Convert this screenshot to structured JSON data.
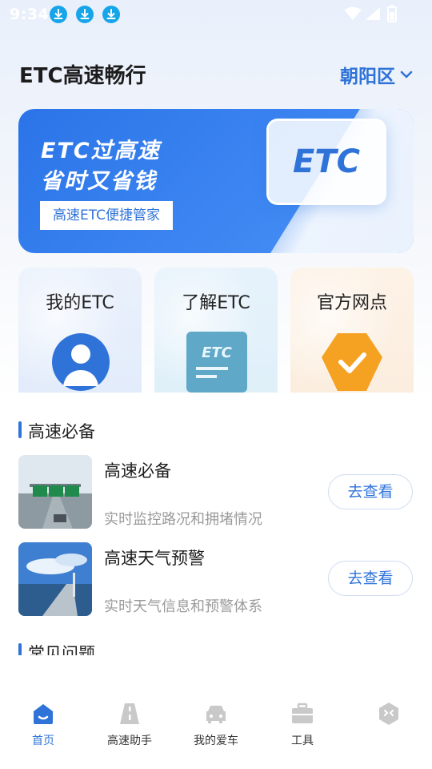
{
  "status_bar": {
    "time": "9:34"
  },
  "header": {
    "title": "ETC高速畅行",
    "region": "朝阳区"
  },
  "banner": {
    "headline_1": "ETC过高速",
    "headline_2": "省时又省钱",
    "subtitle": "高速ETC便捷管家",
    "card_text": "ETC"
  },
  "quick_cards": [
    {
      "label": "我的ETC",
      "icon": "user-icon"
    },
    {
      "label": "了解ETC",
      "icon": "etc-card-icon"
    },
    {
      "label": "官方网点",
      "icon": "check-badge-icon"
    }
  ],
  "section_essentials": {
    "title": "高速必备",
    "items": [
      {
        "title": "高速必备",
        "desc": "实时监控路况和拥堵情况",
        "button": "去查看"
      },
      {
        "title": "高速天气预警",
        "desc": "实时天气信息和预警体系",
        "button": "去查看"
      }
    ]
  },
  "section_faq": {
    "title": "常见问题"
  },
  "tabbar": {
    "tabs": [
      {
        "label": "首页",
        "icon": "home-icon"
      },
      {
        "label": "高速助手",
        "icon": "road-icon"
      },
      {
        "label": "我的爱车",
        "icon": "car-icon"
      },
      {
        "label": "工具",
        "icon": "toolbox-icon"
      },
      {
        "label": "",
        "icon": "profile-icon"
      }
    ]
  },
  "colors": {
    "accent": "#2f73d8",
    "banner": "#2b74e8",
    "muted_text": "#9a9a9a"
  }
}
